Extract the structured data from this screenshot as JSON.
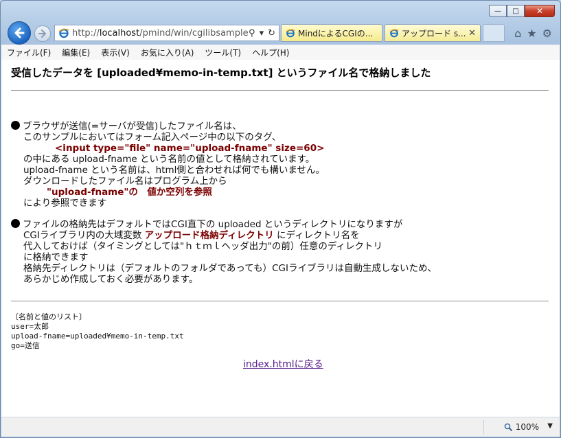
{
  "window": {
    "controls": {
      "minimize": "—",
      "maximize": "□",
      "close": "✕"
    }
  },
  "nav": {
    "address_prefix": "http://",
    "address_host": "localhost",
    "address_path": "/pmind/win/cgilibsample/t",
    "tools": {
      "search": "⚲",
      "dropdown": "▾",
      "refresh": "↻"
    }
  },
  "tabs": [
    {
      "label": "MindによるCGIの...",
      "active": false
    },
    {
      "label": "アップロード s...",
      "active": true,
      "close": "✕"
    }
  ],
  "toolbar_icons": {
    "home": "⌂",
    "favorites": "★",
    "settings": "⚙"
  },
  "menu": [
    "ファイル(F)",
    "編集(E)",
    "表示(V)",
    "お気に入り(A)",
    "ツール(T)",
    "ヘルプ(H)"
  ],
  "page": {
    "heading": "受信したデータを [uploaded¥memo-in-temp.txt] というファイル名で格納しました",
    "section1": {
      "line1": "ブラウザが送信(=サーバが受信)したファイル名は、",
      "line2": "このサンプルにおいてはフォーム記入ページ中の以下のタグ、",
      "tag": "<input type=\"file\" name=\"upload-fname\" size=60>",
      "line3": "の中にある upload-fname という名前の値として格納されています。",
      "line4": "upload-fname という名前は、html側と合わせれば何でも構いません。",
      "line5": "ダウンロードしたファイル名はプログラム上から",
      "var_ref": "\"upload-fname\"の　値か空列を参照",
      "line6": "により参照できます"
    },
    "section2": {
      "line1": "ファイルの格納先はデフォルトではCGI直下の uploaded というディレクトリになりますが",
      "line2_a": "CGIライブラリ内の大域変数 ",
      "line2_red": "アップロード格納ディレクトリ",
      "line2_b": " にディレクトリ名を",
      "line3": "代入しておけば（タイミングとしては\"ｈｔｍｌヘッダ出力\"の前）任意のディレクトリ",
      "line4": "に格納できます",
      "line5": "格納先ディレクトリは（デフォルトのフォルダであっても）CGIライブラリは自動生成しないため、",
      "line6": "あらかじめ作成しておく必要があります。"
    },
    "list": {
      "title": "〔名前と値のリスト〕",
      "items": [
        "user=太郎",
        "upload-fname=uploaded¥memo-in-temp.txt",
        "go=送信"
      ]
    },
    "back_link": "index.htmlに戻る"
  },
  "status": {
    "zoom": "100%",
    "zoom_dropdown": "▼"
  },
  "colors": {
    "accent_red": "#7a0000",
    "link": "#551a8b",
    "frame": "#b9d1ea"
  }
}
